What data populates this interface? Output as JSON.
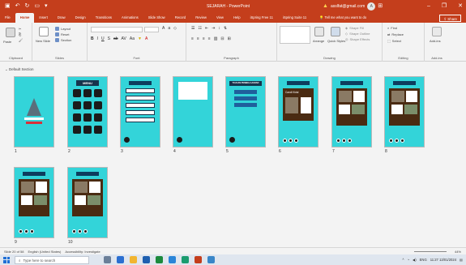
{
  "window": {
    "title": "SEJARAH - PowerPoint",
    "user": "asslfat@gmail.com",
    "user_initial": "A",
    "warning_icon": "warning-icon"
  },
  "tabs": [
    "File",
    "Home",
    "Insert",
    "Draw",
    "Design",
    "Transitions",
    "Animations",
    "Slide Show",
    "Record",
    "Review",
    "View",
    "Help",
    "iSpring Free 11",
    "iSpring Suite 11"
  ],
  "active_tab": "Home",
  "tell_me": "Tell me what you want to do",
  "share_label": "Share",
  "ribbon": {
    "clipboard": {
      "label": "Clipboard",
      "paste": "Paste"
    },
    "slides": {
      "label": "Slides",
      "new_slide": "New Slide",
      "layout": "Layout",
      "reset": "Reset",
      "section": "Section"
    },
    "font": {
      "label": "Font"
    },
    "paragraph": {
      "label": "Paragraph"
    },
    "drawing": {
      "label": "Drawing",
      "arrange": "Arrange",
      "quick_styles": "Quick Styles",
      "shape_fill": "Shape Fill",
      "shape_outline": "Shape Outline",
      "shape_effects": "Shape Effects"
    },
    "editing": {
      "label": "Editing",
      "find": "Find",
      "replace": "Replace",
      "select": "Select"
    },
    "addins": {
      "label": "Add-ins",
      "button": "Add-ins"
    }
  },
  "section": {
    "name": "Default Section"
  },
  "slides": [
    {
      "num": "1",
      "kind": "title"
    },
    {
      "num": "2",
      "kind": "menu",
      "title": "MENU"
    },
    {
      "num": "3",
      "kind": "list"
    },
    {
      "num": "4",
      "kind": "text"
    },
    {
      "num": "5",
      "kind": "objectives",
      "title": "TUJUAN PEMBELAJARAN"
    },
    {
      "num": "6",
      "kind": "content",
      "title": "Candi Kidal"
    },
    {
      "num": "7",
      "kind": "content2"
    },
    {
      "num": "8",
      "kind": "content3"
    },
    {
      "num": "9",
      "kind": "content4"
    },
    {
      "num": "10",
      "kind": "content5"
    }
  ],
  "status": {
    "slide_of": "Slide 20 of 58",
    "language": "English (United States)",
    "accessibility": "Accessibility: Investigate",
    "zoom": "44%"
  },
  "taskbar": {
    "search_placeholder": "Type here to search",
    "lang": "ENG",
    "time": "11:27",
    "date": "13/01/2024"
  },
  "colors": {
    "accent": "#c43e1c",
    "slide_bg": "#33d4d9",
    "navy": "#0d3d5e"
  }
}
